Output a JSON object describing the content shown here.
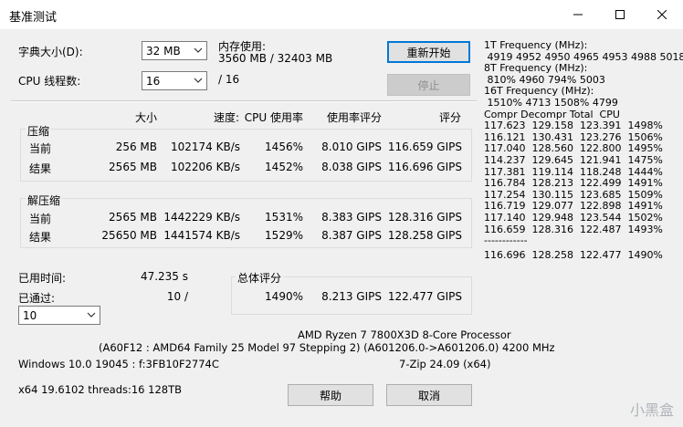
{
  "window": {
    "title": "基准测试"
  },
  "controls": {
    "dict_label": "字典大小(D):",
    "dict_value": "32 MB",
    "threads_label": "CPU 线程数:",
    "threads_value": "16",
    "threads_total": "/ 16",
    "memory_label": "内存使用:",
    "memory_value": "3560 MB / 32403 MB",
    "restart_label": "重新开始",
    "stop_label": "停止"
  },
  "table_headers": {
    "size": "大小",
    "speed": "速度:",
    "cpu_usage": "CPU 使用率",
    "rating_usage": "使用率评分",
    "rating": "评分"
  },
  "compress": {
    "title": "压缩",
    "rows": [
      {
        "label": "当前",
        "size": "256 MB",
        "speed": "102174 KB/s",
        "usage": "1456%",
        "ru": "8.010 GIPS",
        "rating": "116.659 GIPS"
      },
      {
        "label": "结果",
        "size": "2565 MB",
        "speed": "102206 KB/s",
        "usage": "1452%",
        "ru": "8.038 GIPS",
        "rating": "116.696 GIPS"
      }
    ]
  },
  "decompress": {
    "title": "解压缩",
    "rows": [
      {
        "label": "当前",
        "size": "2565 MB",
        "speed": "1442229 KB/s",
        "usage": "1531%",
        "ru": "8.383 GIPS",
        "rating": "128.316 GIPS"
      },
      {
        "label": "结果",
        "size": "25650 MB",
        "speed": "1441574 KB/s",
        "usage": "1529%",
        "ru": "8.387 GIPS",
        "rating": "128.258 GIPS"
      }
    ]
  },
  "elapsed_label": "已用时间:",
  "elapsed_value": "47.235 s",
  "passed_label": "已通过:",
  "passed_value": "10 /",
  "passes_select": "10",
  "total": {
    "title": "总体评分",
    "usage": "1490%",
    "ru": "8.213 GIPS",
    "rating": "122.477 GIPS"
  },
  "cpu_line1": "AMD Ryzen 7 7800X3D 8-Core Processor",
  "cpu_line2": "(A60F12 : AMD64 Family 25 Model 97 Stepping 2) (A601206.0->A601206.0) 4200 MHz",
  "os_line": "Windows 10.0 19045 : f:3FB10F2774C",
  "version": "7-Zip 24.09 (x64)",
  "arch_line": "x64 19.6102 threads:16 128TB",
  "help_label": "帮助",
  "cancel_label": "取消",
  "right_panel": [
    "1T Frequency (MHz):",
    " 4919 4952 4950 4965 4953 4988 5018",
    "8T Frequency (MHz):",
    " 810% 4960 794% 5003",
    "16T Frequency (MHz):",
    " 1510% 4713 1508% 4799",
    "Compr Decompr Total  CPU",
    "117.623  129.158  123.391  1498%",
    "116.121  130.431  123.276  1506%",
    "117.040  128.560  122.800  1495%",
    "114.237  129.645  121.941  1475%",
    "117.381  119.114  118.248  1444%",
    "116.784  128.213  122.499  1491%",
    "117.254  130.115  123.685  1509%",
    "116.719  129.077  122.898  1491%",
    "117.140  129.948  123.544  1502%",
    "116.659  128.316  122.487  1493%",
    "------------",
    "116.696  128.258  122.477  1490%"
  ],
  "watermark": "小黑盒"
}
